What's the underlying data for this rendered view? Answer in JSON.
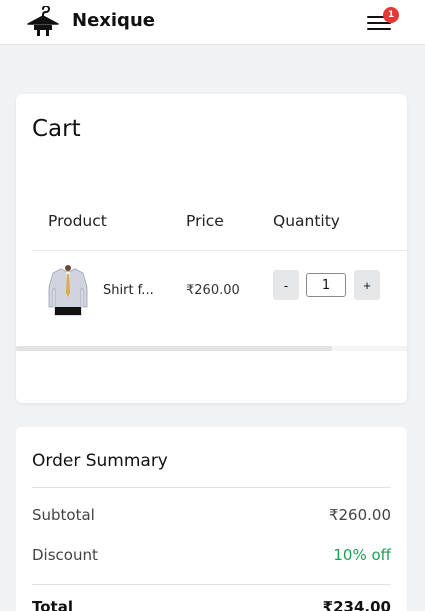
{
  "navbar": {
    "brand": "Nexique",
    "cart_count": "1",
    "logo_icon": "hanger-icon",
    "menu_icon": "hamburger-menu-icon"
  },
  "cart": {
    "title": "Cart",
    "columns": [
      "Product",
      "Price",
      "Quantity"
    ],
    "items": [
      {
        "name": "Shirt f...",
        "price": "₹260.00",
        "quantity": "1",
        "thumb_icon": "shirt-thumbnail"
      }
    ],
    "decrement_label": "-",
    "increment_label": "+"
  },
  "summary": {
    "title": "Order Summary",
    "subtotal_label": "Subtotal",
    "subtotal_value": "₹260.00",
    "discount_label": "Discount",
    "discount_value": "10% off",
    "total_label": "Total",
    "total_value": "₹234.00"
  },
  "colors": {
    "badge": "#e53935",
    "discount": "#1f9d55",
    "background": "#f1f2f4"
  }
}
